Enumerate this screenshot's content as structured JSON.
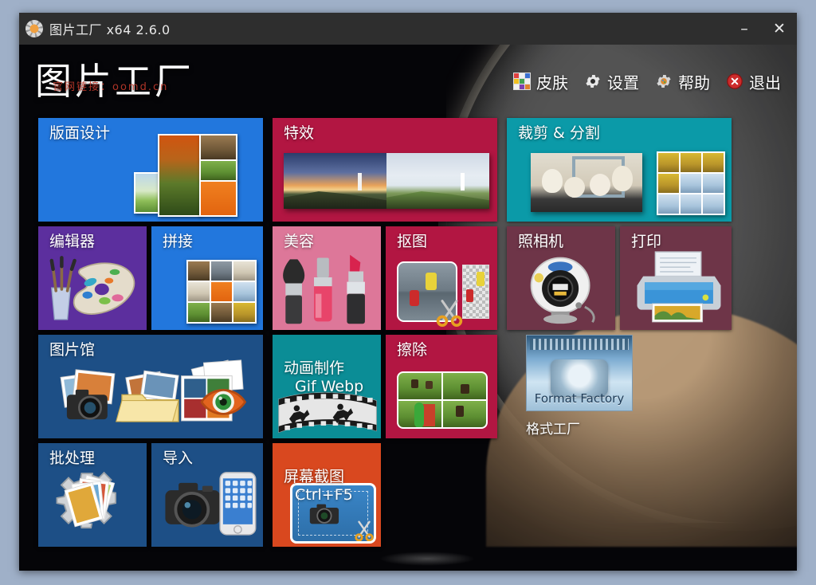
{
  "window": {
    "title": "图片工厂 x64 2.6.0",
    "app_icon": "gear-photo-icon",
    "minimize_label": "–",
    "close_label": "✕"
  },
  "header": {
    "logo": "图片工厂",
    "watermark": "官网链接：oomd.cn",
    "menu": [
      {
        "label": "皮肤",
        "icon": "skin-palette-icon"
      },
      {
        "label": "设置",
        "icon": "gear-icon"
      },
      {
        "label": "帮助",
        "icon": "help-gear-icon"
      },
      {
        "label": "退出",
        "icon": "close-circle-icon"
      }
    ]
  },
  "colors": {
    "blue_bright": "#2277dd",
    "blue_dark": "#1d4f86",
    "purple": "#5c2f9e",
    "crimson": "#b21642",
    "pink": "#dd7799",
    "teal": "#0b9aa8",
    "teal_dark": "#0d7f86",
    "mauve": "#6e3548",
    "orange": "#d9481f",
    "titlebar": "#2e2e2e",
    "desktop": "#9fb0c8"
  },
  "tiles": [
    {
      "name": "layout-design",
      "label": "版面设计",
      "sub": ""
    },
    {
      "name": "editor",
      "label": "编辑器",
      "sub": ""
    },
    {
      "name": "stitch",
      "label": "拼接",
      "sub": ""
    },
    {
      "name": "picture-gallery",
      "label": "图片馆",
      "sub": ""
    },
    {
      "name": "batch-process",
      "label": "批处理",
      "sub": ""
    },
    {
      "name": "import",
      "label": "导入",
      "sub": ""
    },
    {
      "name": "special-effects",
      "label": "特效",
      "sub": ""
    },
    {
      "name": "beauty",
      "label": "美容",
      "sub": ""
    },
    {
      "name": "cutout",
      "label": "抠图",
      "sub": ""
    },
    {
      "name": "animation",
      "label": "动画制作",
      "sub": "Gif Webp"
    },
    {
      "name": "erase",
      "label": "擦除",
      "sub": ""
    },
    {
      "name": "screen-capture",
      "label": "屏幕截图",
      "sub": "Ctrl+F5"
    },
    {
      "name": "crop-split",
      "label": "裁剪 & 分割",
      "sub": ""
    },
    {
      "name": "camera",
      "label": "照相机",
      "sub": ""
    },
    {
      "name": "print",
      "label": "打印",
      "sub": ""
    }
  ],
  "format_factory": {
    "image_text": "Format Factory",
    "caption": "格式工厂"
  }
}
